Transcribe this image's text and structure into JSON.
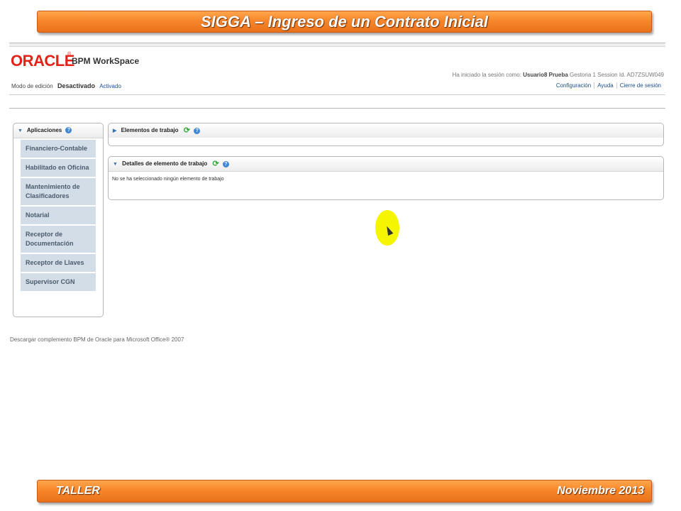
{
  "slide": {
    "title": "SIGGA – Ingreso de un Contrato Inicial",
    "footer_left": "TALLER",
    "footer_right": "Noviembre 2013"
  },
  "app": {
    "brand": "ORACLE",
    "product": "BPM WorkSpace",
    "session": {
      "prefix": "Ha iniciado la sesión como:",
      "user": "Usuario8 Prueba",
      "group": "Gestoria 1",
      "session_label": "Session Id.",
      "session_id": "AD7ZSUW049"
    },
    "edit_mode": {
      "label": "Modo de edición",
      "current": "Desactivado",
      "option": "Activado"
    },
    "top_links": [
      "Configuración",
      "Ayuda",
      "Cierre de sesión"
    ],
    "applications_panel": {
      "title": "Aplicaciones",
      "items": [
        "Financiero-Contable",
        "Habilitado en Oficina",
        "Mantenimiento de Clasificadores",
        "Notarial",
        "Receptor de Documentación",
        "Receptor de Llaves",
        "Supervisor CGN"
      ]
    },
    "work_items_panel": {
      "title": "Elementos de trabajo"
    },
    "details_panel": {
      "title": "Detalles de elemento de trabajo",
      "empty_message": "No se ha seleccionado ningún elemento de trabajo"
    },
    "footer_link": "Descargar complemento BPM de Oracle para Microsoft Office® 2007"
  },
  "icons": {
    "expand": "triangle-right-icon",
    "collapse": "triangle-down-icon",
    "help": "help-icon",
    "refresh": "refresh-icon",
    "cursor": "mouse-pointer-icon"
  },
  "colors": {
    "banner": "#f7872a",
    "oracle_red": "#e2231a",
    "menu_bg": "#d3dde8",
    "link_blue": "#1b4f8a",
    "cursor_highlight": "#f5f500"
  }
}
